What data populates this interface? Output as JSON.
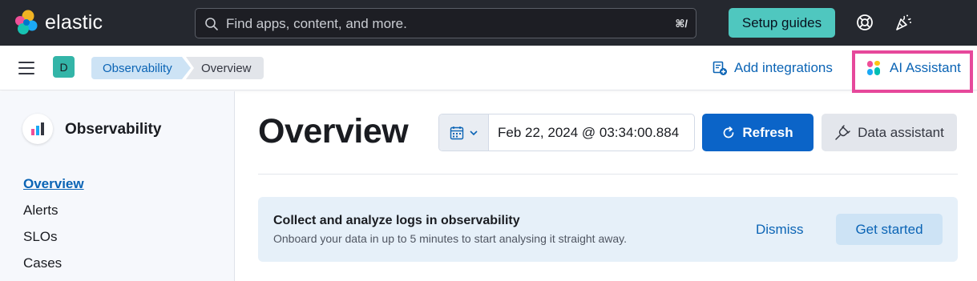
{
  "header": {
    "brand": "elastic",
    "search": {
      "placeholder": "Find apps, content, and more.",
      "shortcut": "⌘/"
    },
    "setup_guides_label": "Setup guides",
    "icons": [
      "help-icon",
      "newsfeed-icon"
    ]
  },
  "subbar": {
    "space_initial": "D",
    "breadcrumbs": [
      "Observability",
      "Overview"
    ],
    "add_integrations_label": "Add integrations",
    "ai_assistant_label": "AI Assistant",
    "highlight_color": "#e6489b"
  },
  "sidebar": {
    "title": "Observability",
    "items": [
      {
        "label": "Overview",
        "active": true
      },
      {
        "label": "Alerts",
        "active": false
      },
      {
        "label": "SLOs",
        "active": false
      },
      {
        "label": "Cases",
        "active": false
      }
    ]
  },
  "main": {
    "title": "Overview",
    "date_value": "Feb 22, 2024 @ 03:34:00.884",
    "refresh_label": "Refresh",
    "data_assistant_label": "Data assistant",
    "callout": {
      "title": "Collect and analyze logs in observability",
      "description": "Onboard your data in up to 5 minutes to start analysing it straight away.",
      "dismiss_label": "Dismiss",
      "get_started_label": "Get started"
    }
  },
  "colors": {
    "header_bg": "#25282f",
    "setup_button": "#4fc7bf",
    "primary": "#0b64c8",
    "link": "#0b64b5"
  }
}
